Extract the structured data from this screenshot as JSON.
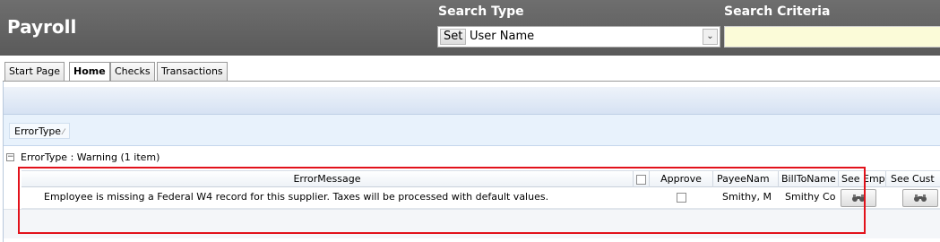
{
  "header": {
    "title": "Payroll",
    "search_type_label": "Search Type",
    "search_criteria_label": "Search Criteria",
    "set_label": "Set",
    "search_type_value": "User Name",
    "search_criteria_value": ""
  },
  "tabs": [
    {
      "label": "Start Page",
      "active": false
    },
    {
      "label": "Home",
      "active": true
    },
    {
      "label": "Checks",
      "active": false
    },
    {
      "label": "Transactions",
      "active": false
    }
  ],
  "grouping": {
    "chip_label": "ErrorType",
    "group_row_text": "ErrorType : Warning (1 item)"
  },
  "grid": {
    "columns": {
      "error_message": "ErrorMessage",
      "approve": "Approve",
      "payee_name": "PayeeNam",
      "bill_to_name": "BillToName",
      "see_empl": "See Empl",
      "see_cust": "See Cust"
    },
    "rows": [
      {
        "error_message": "Employee is missing a Federal W4 record for this supplier. Taxes will be processed with default values.",
        "approve": false,
        "payee_name": "Smithy, M",
        "bill_to_name": "Smithy Co"
      }
    ]
  },
  "icons": {
    "expand": "minus-box-icon",
    "dropdown": "chevron-down-icon",
    "see_empl": "binoculars-icon",
    "see_cust": "binoculars-icon"
  },
  "colors": {
    "header_bg": "#5f5f5f",
    "criteria_bg": "#fbfbd8",
    "highlight_border": "#e2121b"
  }
}
